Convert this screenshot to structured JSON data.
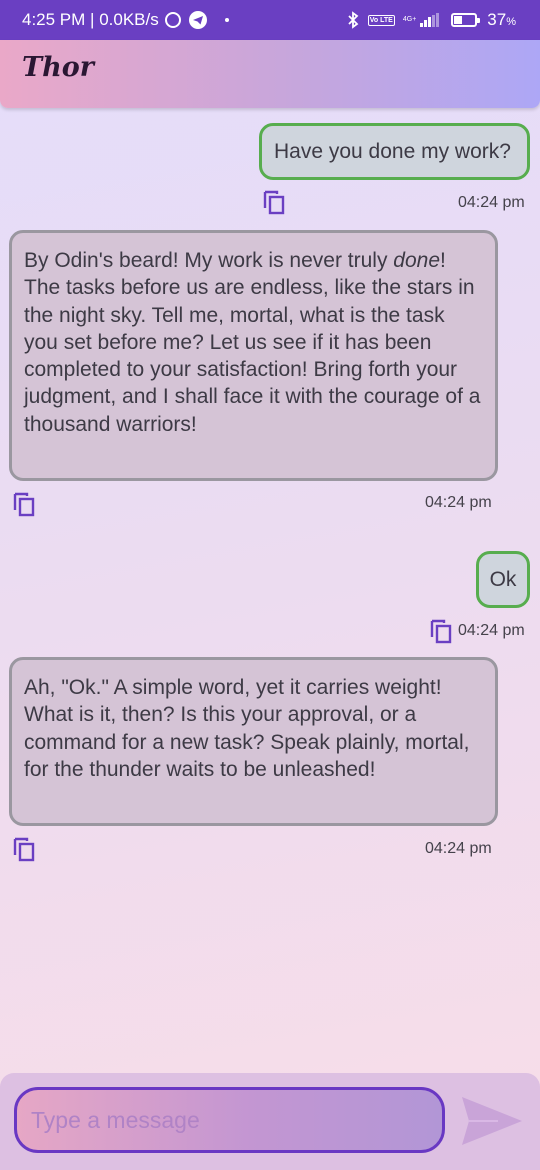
{
  "status_bar": {
    "time": "4:25 PM",
    "speed": "0.0KB/s",
    "net_label": "4G+",
    "volte_label": "Vo LTE",
    "battery_percent": "37",
    "battery_unit": "%"
  },
  "header": {
    "title": "Thor"
  },
  "messages": [
    {
      "role": "user",
      "text": "Have you done my work?",
      "time": "04:24 pm"
    },
    {
      "role": "bot",
      "text_before": "By Odin's beard!  My work is never truly ",
      "text_em": "done",
      "text_after": "!  The tasks before us are endless, like the stars in the night sky.  Tell me, mortal, what is the task you set before me?  Let us see if it has been completed to your satisfaction!  Bring forth your judgment, and I shall face it with the courage of a thousand warriors!",
      "time": "04:24 pm"
    },
    {
      "role": "user",
      "text": "Ok",
      "time": "04:24 pm"
    },
    {
      "role": "bot",
      "text": "Ah, \"Ok.\"  A simple word, yet it carries weight!  What is it, then?  Is this your approval, or a command for a new task?  Speak plainly, mortal, for the thunder waits to be unleashed!",
      "time": "04:24 pm"
    }
  ],
  "composer": {
    "placeholder": "Type a message"
  },
  "colors": {
    "status_bar": "#6a3fc2",
    "user_bubble_border": "#57ad4e",
    "bot_bubble_border": "#9a97a0",
    "accent": "#6938c3"
  },
  "icons": [
    "alarm-icon",
    "telegram-icon",
    "bluetooth-icon",
    "signal-icon",
    "battery-icon",
    "copy-icon",
    "send-icon"
  ]
}
